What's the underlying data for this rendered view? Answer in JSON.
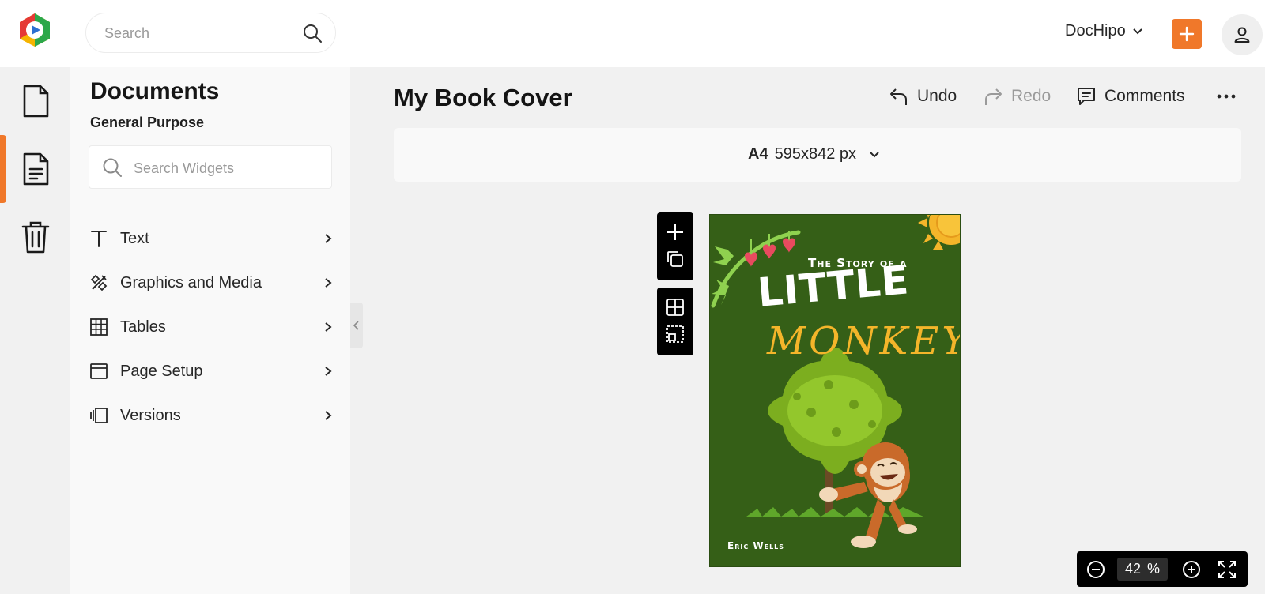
{
  "header": {
    "search_placeholder": "Search",
    "account_name": "DocHipo"
  },
  "rail": {
    "items": [
      "documents-icon",
      "templates-icon",
      "trash-icon"
    ]
  },
  "panel": {
    "title": "Documents",
    "subtitle": "General Purpose",
    "search_placeholder": "Search Widgets",
    "items": [
      {
        "label": "Text",
        "icon": "text-icon"
      },
      {
        "label": "Graphics and Media",
        "icon": "graphics-icon"
      },
      {
        "label": "Tables",
        "icon": "table-icon"
      },
      {
        "label": "Page Setup",
        "icon": "page-setup-icon"
      },
      {
        "label": "Versions",
        "icon": "versions-icon"
      }
    ]
  },
  "editor": {
    "doc_title": "My Book Cover",
    "undo_label": "Undo",
    "redo_label": "Redo",
    "comments_label": "Comments",
    "page_size_name": "A4",
    "page_size_dims": "595x842 px"
  },
  "cover": {
    "line1": "The Story of a",
    "line2": "LITTLE",
    "line3": "MONKEY",
    "author": "Eric Wells",
    "colors": {
      "background": "#355f17",
      "accent": "#f4b52a"
    }
  },
  "zoom": {
    "value": "42",
    "unit": "%"
  },
  "colors": {
    "accent": "#f0782a"
  }
}
